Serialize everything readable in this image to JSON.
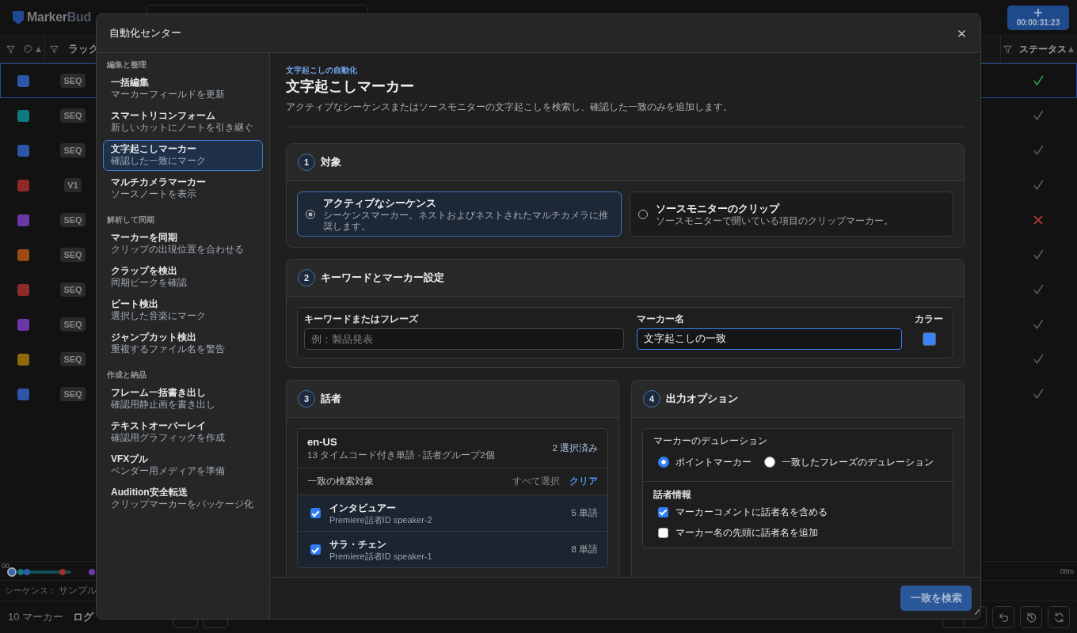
{
  "app": {
    "logo": {
      "primary": "Marker",
      "secondary": "Bud"
    },
    "timecode_button": {
      "label": "00:00:31:23"
    },
    "color_column": {
      "sorted": true
    },
    "track_column": {
      "label": "ラック"
    },
    "status_column": {
      "label": "ステータス",
      "sorted": true
    },
    "rows": [
      {
        "color": "#2c56a6",
        "track": "SEQ",
        "approved": true,
        "selected": true
      },
      {
        "color": "#0e7a80",
        "track": "SEQ",
        "approved": true,
        "selected": false
      },
      {
        "color": "#2c56a6",
        "track": "SEQ",
        "approved": true,
        "selected": false
      },
      {
        "color": "#8e2a2a",
        "track": "V1",
        "approved": true,
        "selected": false
      },
      {
        "color": "#6a38a6",
        "track": "SEQ",
        "approved": false,
        "selected": false
      },
      {
        "color": "#9c4a12",
        "track": "SEQ",
        "approved": true,
        "selected": false
      },
      {
        "color": "#8e2a2a",
        "track": "SEQ",
        "approved": true,
        "selected": false
      },
      {
        "color": "#6a38a6",
        "track": "SEQ",
        "approved": true,
        "selected": false
      },
      {
        "color": "#8c6a08",
        "track": "SEQ",
        "approved": true,
        "selected": false
      },
      {
        "color": "#2c56a6",
        "track": "SEQ",
        "approved": true,
        "selected": false
      }
    ],
    "timeline": {
      "start_label": "00",
      "end_label": "08m",
      "markers": [
        {
          "color": "#0f7a80"
        },
        {
          "color": "#2c5bb0"
        },
        {
          "color": "#a02c2c"
        },
        {
          "color": "#6b38a8"
        }
      ]
    },
    "sequence": {
      "label": "シーケンス：",
      "value": "サンプル"
    },
    "marker_count": "10 マーカー",
    "log_link": "ログ"
  },
  "modal": {
    "title": "自動化センター",
    "nav": [
      {
        "group": "編集と整理",
        "items": [
          {
            "title": "一括編集",
            "subtitle": "マーカーフィールドを更新",
            "selected": false
          },
          {
            "title": "スマートリコンフォーム",
            "subtitle": "新しいカットにノートを引き継ぐ",
            "selected": false
          },
          {
            "title": "文字起こしマーカー",
            "subtitle": "確認した一致にマーク",
            "selected": true
          },
          {
            "title": "マルチカメラマーカー",
            "subtitle": "ソースノートを表示",
            "selected": false
          }
        ]
      },
      {
        "group": "解析して同期",
        "items": [
          {
            "title": "マーカーを同期",
            "subtitle": "クリップの出現位置を合わせる",
            "selected": false
          },
          {
            "title": "クラップを検出",
            "subtitle": "同期ピークを確認",
            "selected": false
          },
          {
            "title": "ビート検出",
            "subtitle": "選択した音楽にマーク",
            "selected": false
          },
          {
            "title": "ジャンプカット検出",
            "subtitle": "重複するファイル名を警告",
            "selected": false
          }
        ]
      },
      {
        "group": "作成と納品",
        "items": [
          {
            "title": "フレーム一括書き出し",
            "subtitle": "確認用静止画を書き出し",
            "selected": false
          },
          {
            "title": "テキストオーバーレイ",
            "subtitle": "確認用グラフィックを作成",
            "selected": false
          },
          {
            "title": "VFXプル",
            "subtitle": "ベンダー用メディアを準備",
            "selected": false
          },
          {
            "title": "Audition安全転送",
            "subtitle": "クリップマーカーをパッケージ化",
            "selected": false
          }
        ]
      }
    ],
    "eyebrow": "文字起こしの自動化",
    "heading": "文字起こしマーカー",
    "description": "アクティブなシーケンスまたはソースモニターの文字起こしを検索し、確認した一致のみを追加します。",
    "target": {
      "number": "1",
      "title": "対象",
      "options": [
        {
          "title": "アクティブなシーケンス",
          "description": "シーケンスマーカー。ネストおよびネストされたマルチカメラに推奨します。",
          "selected": true
        },
        {
          "title": "ソースモニターのクリップ",
          "description": "ソースモニターで開いている項目のクリップマーカー。",
          "selected": false
        }
      ]
    },
    "keyword_settings": {
      "number": "2",
      "title": "キーワードとマーカー設定",
      "keyword": {
        "label": "キーワードまたはフレーズ",
        "placeholder": "例：製品発表"
      },
      "marker_name": {
        "label": "マーカー名",
        "value": "文字起こしの一致",
        "focused": true
      },
      "color_picker": {
        "label": "カラー",
        "color": "#3b82f6"
      }
    },
    "speakers": {
      "number": "3",
      "title": "話者",
      "language": "en-US",
      "summary": "13 タイムコード付き単語 · 話者グループ2個",
      "selected_count": "2 選択済み",
      "filter_label": "一致の検索対象",
      "select_all": {
        "label": "すべて選択",
        "disabled": true
      },
      "clear": {
        "label": "クリア",
        "disabled": false
      },
      "items": [
        {
          "name": "インタビュアー",
          "id": "Premiere話者ID speaker-2",
          "words": "5 単語",
          "checked": true
        },
        {
          "name": "サラ・チェン",
          "id": "Premiere話者ID speaker-1",
          "words": "8 単語",
          "checked": true
        }
      ]
    },
    "output": {
      "number": "4",
      "title": "出力オプション",
      "duration_label": "マーカーのデュレーション",
      "duration_options": [
        {
          "label": "ポイントマーカー",
          "selected": true
        },
        {
          "label": "一致したフレーズのデュレーション",
          "selected": false
        }
      ],
      "speaker_label": "話者情報",
      "speaker_options": [
        {
          "label": "マーカーコメントに話者名を含める",
          "checked": true
        },
        {
          "label": "マーカー名の先頭に話者名を追加",
          "checked": false
        }
      ]
    },
    "search_button": {
      "label": "一致を検索",
      "disabled": true
    }
  }
}
